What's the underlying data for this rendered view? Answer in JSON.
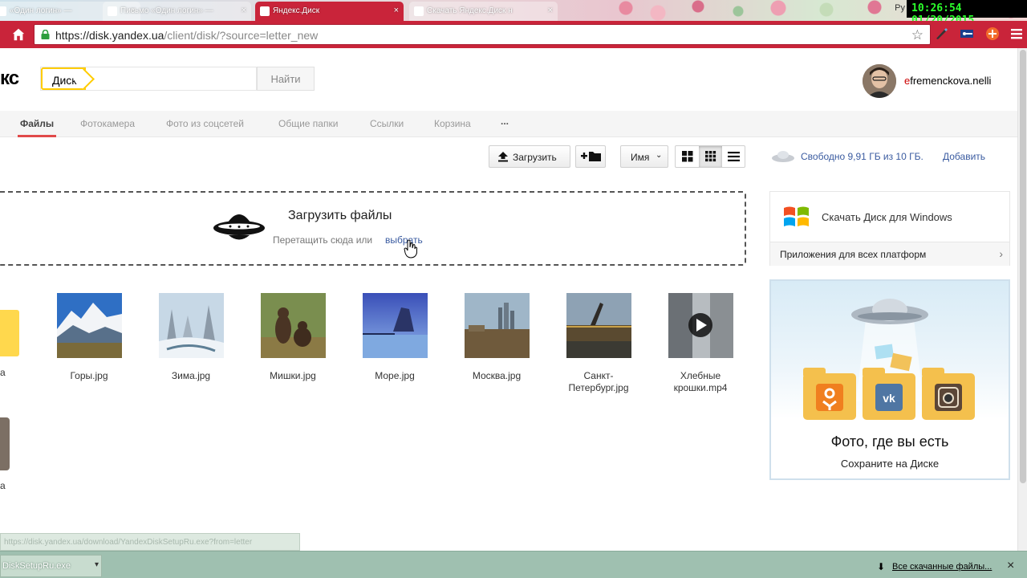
{
  "browser": {
    "tabs": [
      {
        "title": "«Один логин» —"
      },
      {
        "title": "Письмо «Один логин» —"
      },
      {
        "title": "Яндекс.Диск"
      },
      {
        "title": "Скачать Яндекс.Диск н"
      }
    ],
    "url_host": "https://disk.yandex.ua",
    "url_path": "/client/disk/?source=letter_new",
    "clock": "10:26:54  01/20/2015",
    "clock_prefix": "Ру"
  },
  "header": {
    "logo_fragment": "кс",
    "service_chip": "Диск",
    "search_value": "",
    "find_label": "Найти",
    "user_name_first": "e",
    "user_name_rest": "fremenckova.nelli"
  },
  "nav": {
    "tabs": [
      "Файлы",
      "Фотокамера",
      "Фото из соцсетей",
      "Общие папки",
      "Ссылки",
      "Корзина",
      "..."
    ]
  },
  "actions": {
    "upload": "Загрузить",
    "sort": "Имя",
    "space": "Свободно 9,91 ГБ из 10 ГБ.",
    "add": "Добавить"
  },
  "dropzone": {
    "title": "Загрузить файлы",
    "subtitle": "Перетащить сюда или",
    "link": "выбрать"
  },
  "files": {
    "cut_label_1": "а",
    "cut_label_2": "а",
    "items": [
      {
        "name": "Горы.jpg"
      },
      {
        "name": "Зима.jpg"
      },
      {
        "name": "Мишки.jpg"
      },
      {
        "name": "Море.jpg"
      },
      {
        "name": "Москва.jpg"
      },
      {
        "name": "Санкт-Петербург.jpg"
      },
      {
        "name": "Хлебные крошки.mp4"
      }
    ]
  },
  "sidebar": {
    "windows_title": "Скачать Диск для Windows",
    "windows_foot": "Приложения для всех платформ",
    "promo_title": "Фото, где вы есть",
    "promo_sub": "Сохраните на Диске"
  },
  "bottom": {
    "status": "https://disk.yandex.ua/download/YandexDiskSetupRu.exe?from=letter",
    "download_item": "DiskSetupRu.exe",
    "all_downloads": "Все скачанные файлы..."
  },
  "colors": {
    "browser_red": "#c9243a",
    "accent_yellow": "#ffcc00",
    "link_blue": "#3a5ba0",
    "nav_underline": "#e04a4a"
  }
}
